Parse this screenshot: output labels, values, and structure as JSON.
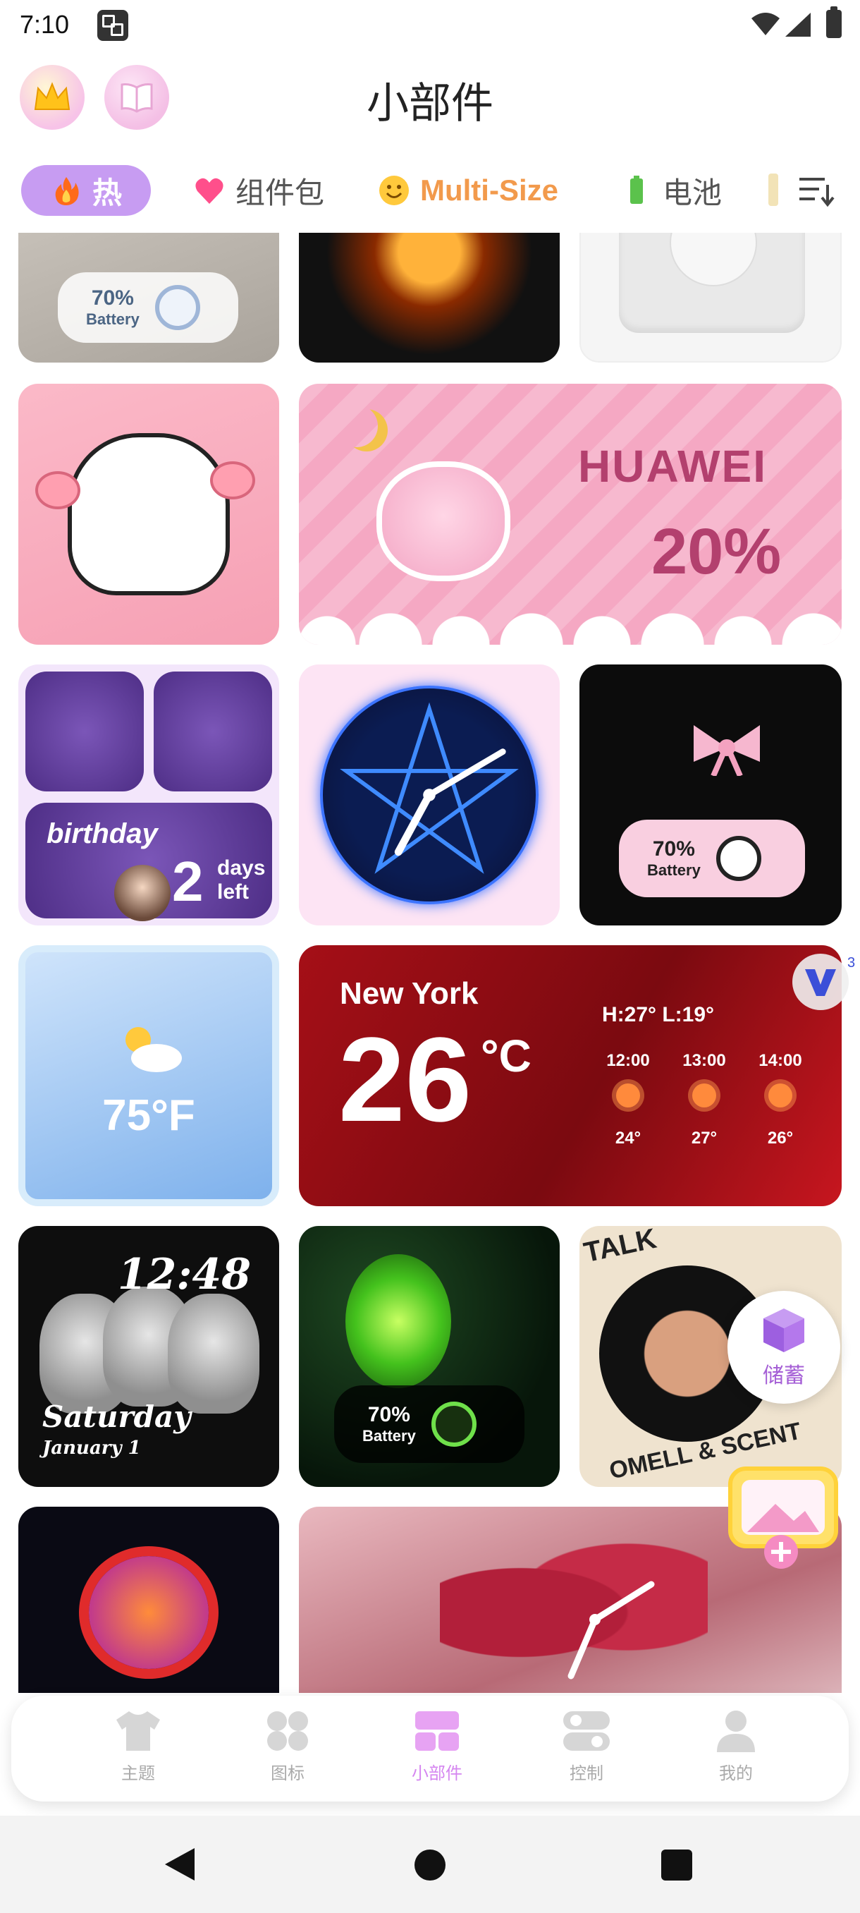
{
  "status_bar": {
    "time": "7:10",
    "icons": [
      "qr-code-icon",
      "wifi-icon",
      "signal-icon",
      "battery-icon"
    ]
  },
  "header": {
    "title": "小部件",
    "left_buttons": [
      "crown-icon",
      "book-icon"
    ]
  },
  "tabs": [
    {
      "label": "热",
      "icon": "fire-icon",
      "active": true
    },
    {
      "label": "组件包",
      "icon": "heart-icon"
    },
    {
      "label": "Multi-Size",
      "icon": "smile-icon"
    },
    {
      "label": "电池",
      "icon": "battery-icon"
    }
  ],
  "sort_icon": "sort-icon",
  "widgets": {
    "r0a": {
      "pct": "70%",
      "label": "Battery"
    },
    "r1b": {
      "brand": "HUAWEI",
      "pct": "20%"
    },
    "r2a": {
      "title": "birthday",
      "days": "2",
      "days_word1": "days",
      "days_word2": "left"
    },
    "r2c": {
      "pct": "70%",
      "label": "Battery"
    },
    "r3a": {
      "temp": "75°F"
    },
    "r3b": {
      "city": "New York",
      "temp": "26",
      "unit": "°C",
      "high_low": "H:27°  L:19°",
      "hours": [
        {
          "time": "12:00",
          "temp": "24°"
        },
        {
          "time": "13:00",
          "temp": "27°"
        },
        {
          "time": "14:00",
          "temp": "26°"
        }
      ]
    },
    "r4a": {
      "time": "12:48",
      "day": "Saturday",
      "date": "January 1"
    },
    "r4b": {
      "pct": "70%",
      "label": "Battery"
    },
    "r4c": {
      "top": "TALK",
      "bottom": "OMELL & SCENT"
    }
  },
  "floating": {
    "v_badge_count": "3",
    "store_label": "储蓄"
  },
  "bottom_nav": [
    {
      "label": "主题",
      "icon": "shirt-icon"
    },
    {
      "label": "图标",
      "icon": "grid-icon"
    },
    {
      "label": "小部件",
      "icon": "widget-icon",
      "active": true
    },
    {
      "label": "控制",
      "icon": "toggle-icon"
    },
    {
      "label": "我的",
      "icon": "person-icon"
    }
  ],
  "colors": {
    "accent": "#c79cf2",
    "multi_size": "#f29a4c",
    "active_nav": "#d586f0"
  }
}
